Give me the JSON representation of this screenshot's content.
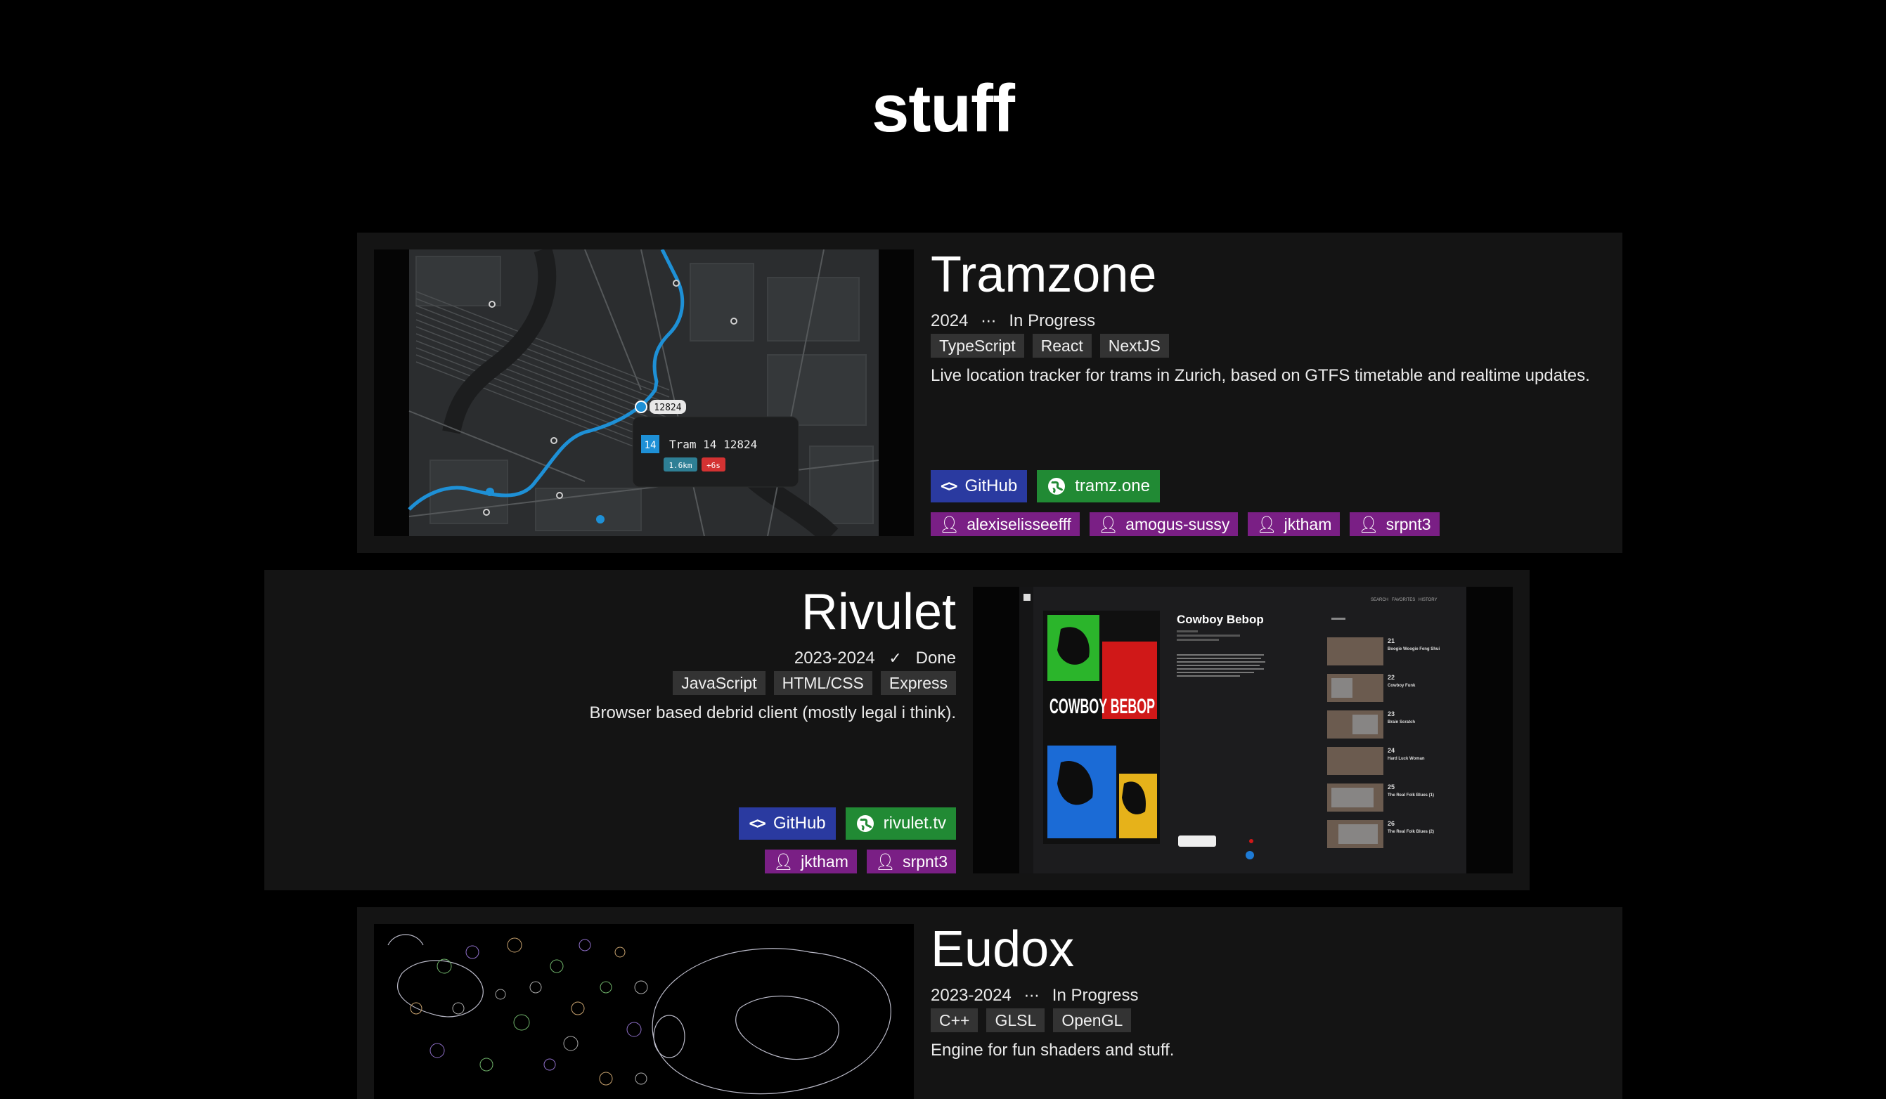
{
  "page": {
    "title": "stuff"
  },
  "projects": [
    {
      "title": "Tramzone",
      "year": "2024",
      "status_icon": "ellipsis-icon",
      "status": "In Progress",
      "tags": [
        "TypeScript",
        "React",
        "NextJS"
      ],
      "description": "Live location tracker for trams in Zurich, based on GTFS timetable and realtime updates.",
      "links": [
        {
          "label": "GitHub",
          "icon": "code-icon",
          "color": "#2a3aa0"
        },
        {
          "label": "tramz.one",
          "icon": "globe-icon",
          "color": "#218a34"
        }
      ],
      "people": [
        "alexiselisseefff",
        "amogus-sussy",
        "jktham",
        "srpnt3"
      ],
      "screenshot": {
        "vehicle_id": "12824",
        "popup_line": "14",
        "popup_title": "Tram 14 12824",
        "popup_distance": "1.6km",
        "popup_delay": "+6s"
      }
    },
    {
      "title": "Rivulet",
      "year": "2023-2024",
      "status_icon": "checkmark-icon",
      "status": "Done",
      "tags": [
        "JavaScript",
        "HTML/CSS",
        "Express"
      ],
      "description": "Browser based debrid client (mostly legal i think).",
      "links": [
        {
          "label": "GitHub",
          "icon": "code-icon",
          "color": "#2a3aa0"
        },
        {
          "label": "rivulet.tv",
          "icon": "globe-icon",
          "color": "#218a34"
        }
      ],
      "people": [
        "jktham",
        "srpnt3"
      ],
      "screenshot": {
        "show_title": "Cowboy Bebop",
        "poster_text": "COWBOY BEBOP",
        "nav": [
          "SEARCH",
          "FAVORITES",
          "HISTORY"
        ],
        "episodes": [
          {
            "num": "21",
            "name": "Boogie Woogie Feng Shui"
          },
          {
            "num": "22",
            "name": "Cowboy Funk"
          },
          {
            "num": "23",
            "name": "Brain Scratch"
          },
          {
            "num": "24",
            "name": "Hard Luck Woman"
          },
          {
            "num": "25",
            "name": "The Real Folk Blues (1)"
          },
          {
            "num": "26",
            "name": "The Real Folk Blues (2)"
          }
        ]
      }
    },
    {
      "title": "Eudox",
      "year": "2023-2024",
      "status_icon": "ellipsis-icon",
      "status": "In Progress",
      "tags": [
        "C++",
        "GLSL",
        "OpenGL"
      ],
      "description": "Engine for fun shaders and stuff."
    }
  ],
  "colors": {
    "background": "#000000",
    "card": "#141414",
    "tag": "#333333",
    "github": "#2a3aa0",
    "site": "#218a34",
    "person": "#7a1f85",
    "tram_line": "#1e90d6"
  }
}
